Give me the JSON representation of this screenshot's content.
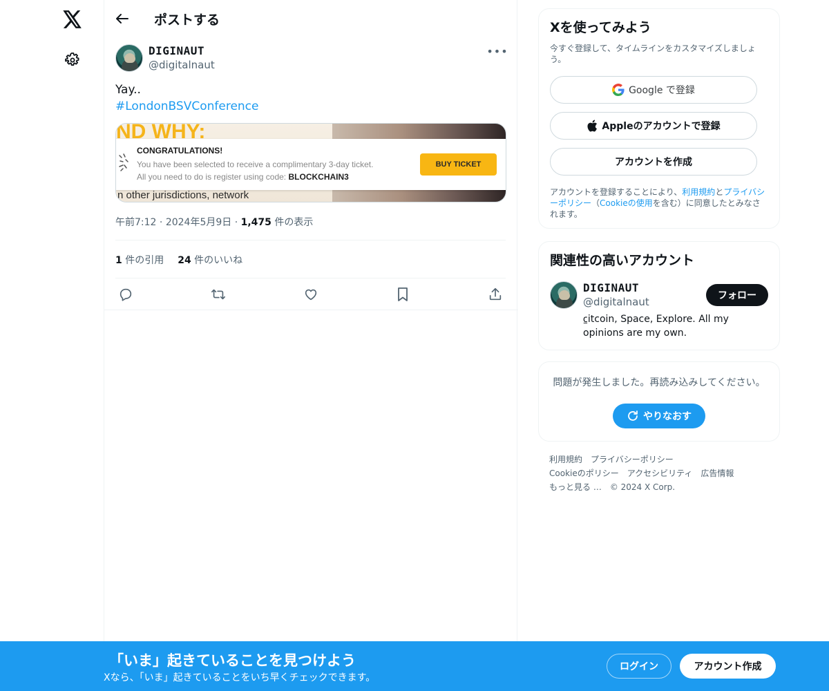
{
  "nav": {
    "logo_icon": "x-logo-icon",
    "settings_icon": "gear-icon"
  },
  "header": {
    "title": "ポストする",
    "back_icon": "arrow-left-icon"
  },
  "post": {
    "display_name": "DIGINAUT",
    "handle": "@digitalnaut",
    "text_line1": "Yay..",
    "hashtag": "#LondonBSVConference",
    "media": {
      "bg_headline": "ND WHY:",
      "bg_bottom": "n other jurisdictions, network",
      "banner_title": "CONGRATULATIONS!",
      "banner_line1": "You have been selected to receive a complimentary 3-day ticket.",
      "banner_line2_prefix": "All you need to do is register using code:",
      "banner_code": "BLOCKCHAIN3",
      "banner_button": "BUY TICKET"
    },
    "time": "午前7:12",
    "date": "2024年5月9日",
    "views_count": "1,475",
    "views_label": "件の表示",
    "separator": "·",
    "quotes_count": "1",
    "quotes_label": "件の引用",
    "likes_count": "24",
    "likes_label": "件のいいね",
    "actions": [
      "reply-icon",
      "repost-icon",
      "like-icon",
      "bookmark-icon",
      "share-icon"
    ]
  },
  "signup_card": {
    "title": "Xを使ってみよう",
    "subtitle": "今すぐ登録して、タイムラインをカスタマイズしましょう。",
    "google_button": "Google で登録",
    "apple_button": "Appleのアカウントで登録",
    "create_button": "アカウントを作成",
    "terms_prefix": "アカウントを登録することにより、",
    "terms_link1": "利用規約",
    "terms_and": "と",
    "terms_link2": "プライバシーポリシー",
    "terms_paren_open": "（",
    "terms_link3": "Cookieの使用",
    "terms_suffix": "を含む）に同意したとみなされます。"
  },
  "related": {
    "title": "関連性の高いアカウント",
    "display_name": "DIGINAUT",
    "handle": "@digitalnaut",
    "bio": "⃀itcoin, Space, Explore. All my opinions are my own.",
    "follow_button": "フォロー"
  },
  "error_card": {
    "message": "問題が発生しました。再読み込みしてください。",
    "retry_button": "やりなおす"
  },
  "footer": {
    "links": [
      "利用規約",
      "プライバシーポリシー",
      "Cookieのポリシー",
      "アクセシビリティ",
      "広告情報",
      "もっと見る …",
      "© 2024 X Corp."
    ]
  },
  "bottom_bar": {
    "title": "「いま」起きていることを見つけよう",
    "subtitle": "Xなら、「いま」起きていることをいち早くチェックできます。",
    "login_button": "ログイン",
    "signup_button": "アカウント作成",
    "bg_color": "#1d9bf0"
  }
}
